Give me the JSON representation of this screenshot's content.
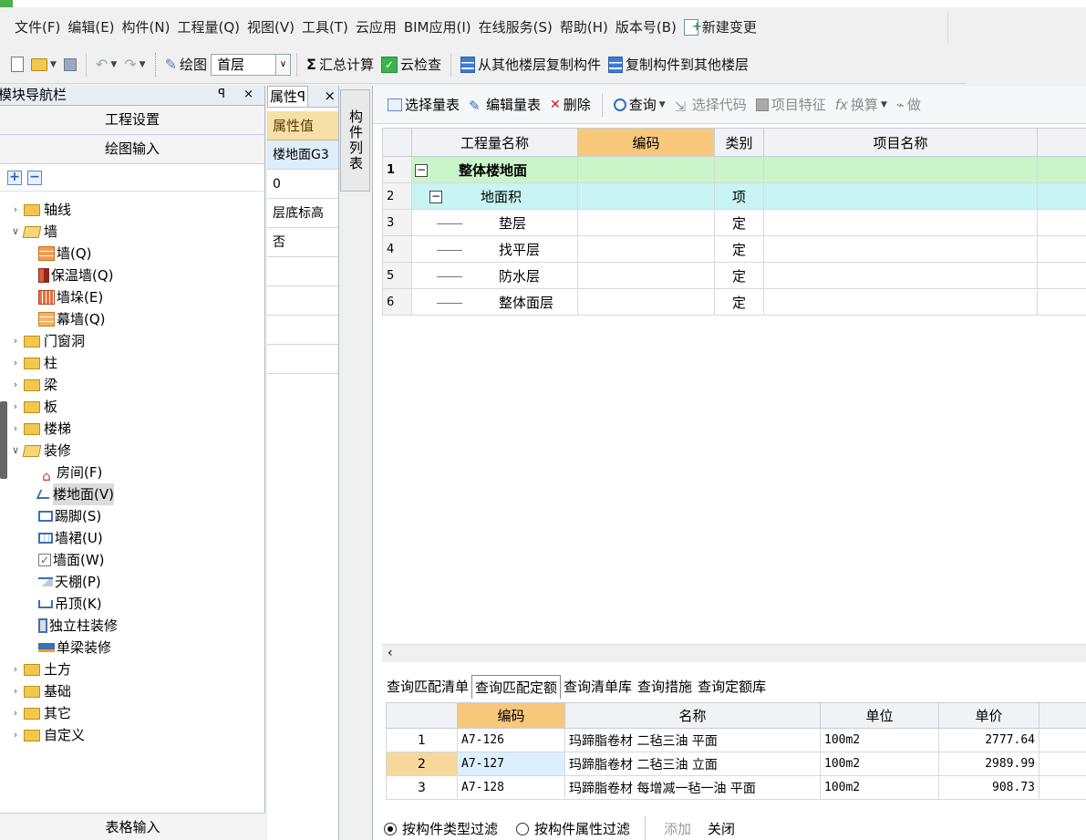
{
  "menu": [
    "文件(F)",
    "编辑(E)",
    "构件(N)",
    "工程量(Q)",
    "视图(V)",
    "工具(T)",
    "云应用",
    "BIM应用(I)",
    "在线服务(S)",
    "帮助(H)",
    "版本号(B)"
  ],
  "menu_special": "新建变更",
  "toolbar": {
    "draw": "绘图",
    "floor": "首层",
    "summary": "汇总计算",
    "cloud_check": "云检查",
    "copy_from": "从其他楼层复制构件",
    "copy_to": "复制构件到其他楼层"
  },
  "nav": {
    "title": "模块导航栏",
    "pin": "ᵖ ×",
    "project_settings": "工程设置",
    "drawing_input": "绘图输入",
    "table_input": "表格输入",
    "tree": [
      {
        "label": "轴线",
        "level": 0,
        "open": false
      },
      {
        "label": "墙",
        "level": 0,
        "open": true
      },
      {
        "label": "墙(Q)",
        "level": 1,
        "icon": "wall-icon"
      },
      {
        "label": "保温墙(Q)",
        "level": 1,
        "icon": "insulated-wall-icon"
      },
      {
        "label": "墙垛(E)",
        "level": 1,
        "icon": "pilaster-icon"
      },
      {
        "label": "幕墙(Q)",
        "level": 1,
        "icon": "curtain-wall-icon"
      },
      {
        "label": "门窗洞",
        "level": 0,
        "open": false
      },
      {
        "label": "柱",
        "level": 0,
        "open": false
      },
      {
        "label": "梁",
        "level": 0,
        "open": false
      },
      {
        "label": "板",
        "level": 0,
        "open": false
      },
      {
        "label": "楼梯",
        "level": 0,
        "open": false
      },
      {
        "label": "装修",
        "level": 0,
        "open": true
      },
      {
        "label": "房间(F)",
        "level": 1,
        "icon": "room-icon"
      },
      {
        "label": "楼地面(V)",
        "level": 1,
        "icon": "floor-icon",
        "selected": true
      },
      {
        "label": "踢脚(S)",
        "level": 1,
        "icon": "skirting-icon"
      },
      {
        "label": "墙裙(U)",
        "level": 1,
        "icon": "dado-icon"
      },
      {
        "label": "墙面(W)",
        "level": 1,
        "icon": "wall-surface-icon"
      },
      {
        "label": "天棚(P)",
        "level": 1,
        "icon": "ceiling-icon"
      },
      {
        "label": "吊顶(K)",
        "level": 1,
        "icon": "suspended-ceiling-icon"
      },
      {
        "label": "独立柱装修",
        "level": 1,
        "icon": "column-finish-icon"
      },
      {
        "label": "单梁装修",
        "level": 1,
        "icon": "beam-finish-icon"
      },
      {
        "label": "土方",
        "level": 0,
        "open": false
      },
      {
        "label": "基础",
        "level": 0,
        "open": false
      },
      {
        "label": "其它",
        "level": 0,
        "open": false
      },
      {
        "label": "自定义",
        "level": 0,
        "open": false
      }
    ]
  },
  "props": {
    "tab_label": "属性",
    "header": "属性值",
    "values": [
      "楼地面G3",
      "0",
      "层底标高",
      "否",
      "",
      "",
      "",
      ""
    ]
  },
  "component_list_tab": "构件列表",
  "qty_toolbar": {
    "select_table": "选择量表",
    "edit_table": "编辑量表",
    "delete": "删除",
    "query": "查询",
    "select_code": "选择代码",
    "item_feature": "项目特征",
    "convert": "换算",
    "do": "做"
  },
  "qty_table": {
    "columns": [
      "工程量名称",
      "编码",
      "类别",
      "项目名称"
    ],
    "rows": [
      {
        "no": "1",
        "name": "整体楼地面",
        "code": "",
        "type": "",
        "item": "",
        "level": 0
      },
      {
        "no": "2",
        "name": "地面积",
        "code": "",
        "type": "项",
        "item": "",
        "level": 1
      },
      {
        "no": "3",
        "name": "垫层",
        "code": "",
        "type": "定",
        "item": "",
        "level": 2
      },
      {
        "no": "4",
        "name": "找平层",
        "code": "",
        "type": "定",
        "item": "",
        "level": 2
      },
      {
        "no": "5",
        "name": "防水层",
        "code": "",
        "type": "定",
        "item": "",
        "level": 2
      },
      {
        "no": "6",
        "name": "整体面层",
        "code": "",
        "type": "定",
        "item": "",
        "level": 2
      }
    ]
  },
  "bottom_tabs": [
    "查询匹配清单",
    "查询匹配定额",
    "查询清单库",
    "查询措施",
    "查询定额库"
  ],
  "bottom_active_tab": 1,
  "quota_table": {
    "columns": [
      "编码",
      "名称",
      "单位",
      "单价"
    ],
    "rows": [
      {
        "idx": "1",
        "code": "A7-126",
        "name": "玛蹄脂卷材 二毡三油 平面",
        "unit": "100m2",
        "price": "2777.64"
      },
      {
        "idx": "2",
        "code": "A7-127",
        "name": "玛蹄脂卷材 二毡三油 立面",
        "unit": "100m2",
        "price": "2989.99",
        "selected": true
      },
      {
        "idx": "3",
        "code": "A7-128",
        "name": "玛蹄脂卷材 每增减一毡一油 平面",
        "unit": "100m2",
        "price": "908.73"
      }
    ]
  },
  "filter": {
    "by_type": "按构件类型过滤",
    "by_attr": "按构件属性过滤",
    "add": "添加",
    "close": "关闭"
  }
}
